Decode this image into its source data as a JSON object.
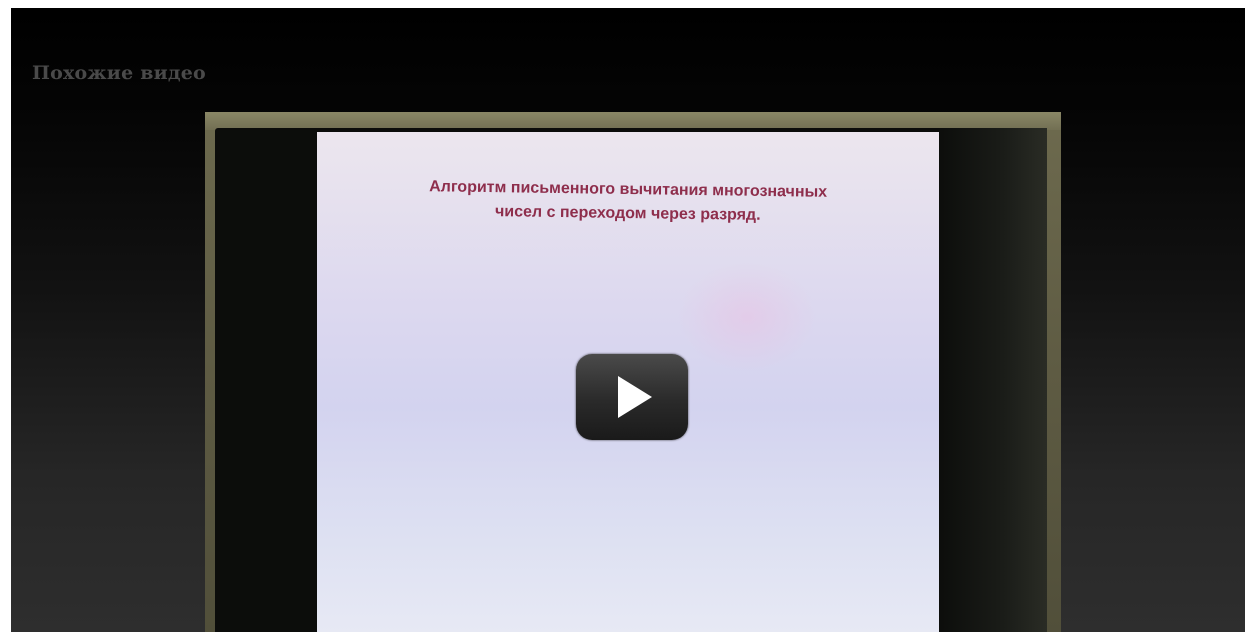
{
  "related": {
    "heading": "Похожие видео"
  },
  "video": {
    "slide_title_line1": "Алгоритм письменного вычитания многозначных",
    "slide_title_line2": "чисел с переходом через разряд.",
    "play_icon": "play-icon",
    "accent_color": "#8e2e4c"
  }
}
